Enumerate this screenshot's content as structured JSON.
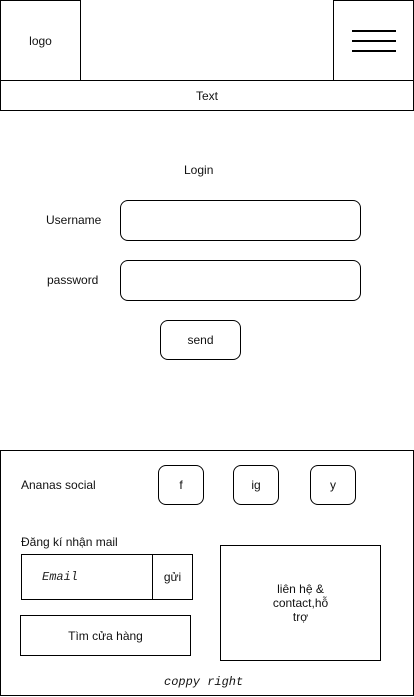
{
  "header": {
    "logo_text": "logo",
    "menu_icon": "hamburger-menu-icon",
    "banner_text": "Text"
  },
  "login": {
    "title": "Login",
    "username_label": "Username",
    "password_label": "password",
    "username_value": "",
    "password_value": "",
    "send_label": "send"
  },
  "footer": {
    "social_label": "Ananas social",
    "social_buttons": [
      "f",
      "ig",
      "y"
    ],
    "newsletter_label": "Đăng kí nhận mail",
    "email_placeholder": "Email",
    "submit_label": "gửi",
    "store_button_label": "Tìm cửa hàng",
    "contact_text": "liên hệ & contact,hỗ trợ",
    "copyright": "coppy right"
  }
}
